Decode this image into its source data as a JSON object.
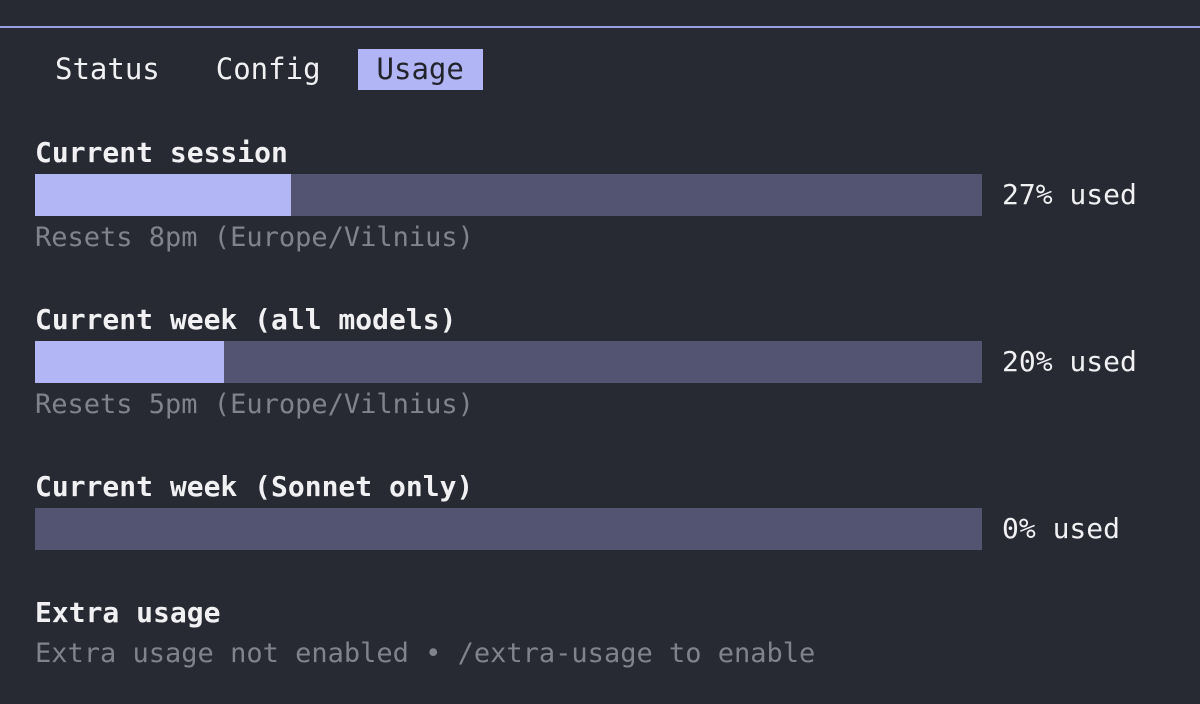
{
  "tabs": [
    {
      "label": "Status",
      "active": false
    },
    {
      "label": "Config",
      "active": false
    },
    {
      "label": "Usage",
      "active": true
    }
  ],
  "usage": [
    {
      "title": "Current session",
      "percent": 27,
      "used_label": "27% used",
      "reset": "Resets 8pm (Europe/Vilnius)"
    },
    {
      "title": "Current week (all models)",
      "percent": 20,
      "used_label": "20% used",
      "reset": "Resets 5pm (Europe/Vilnius)"
    },
    {
      "title": "Current week (Sonnet only)",
      "percent": 0,
      "used_label": "0% used"
    }
  ],
  "extra": {
    "title": "Extra usage",
    "text": "Extra usage not enabled • /extra-usage to enable"
  },
  "colors": {
    "background": "#282a33",
    "accent": "#b3b6f5",
    "track": "#525471",
    "muted_text": "#80838d",
    "text": "#f1f1f3"
  }
}
